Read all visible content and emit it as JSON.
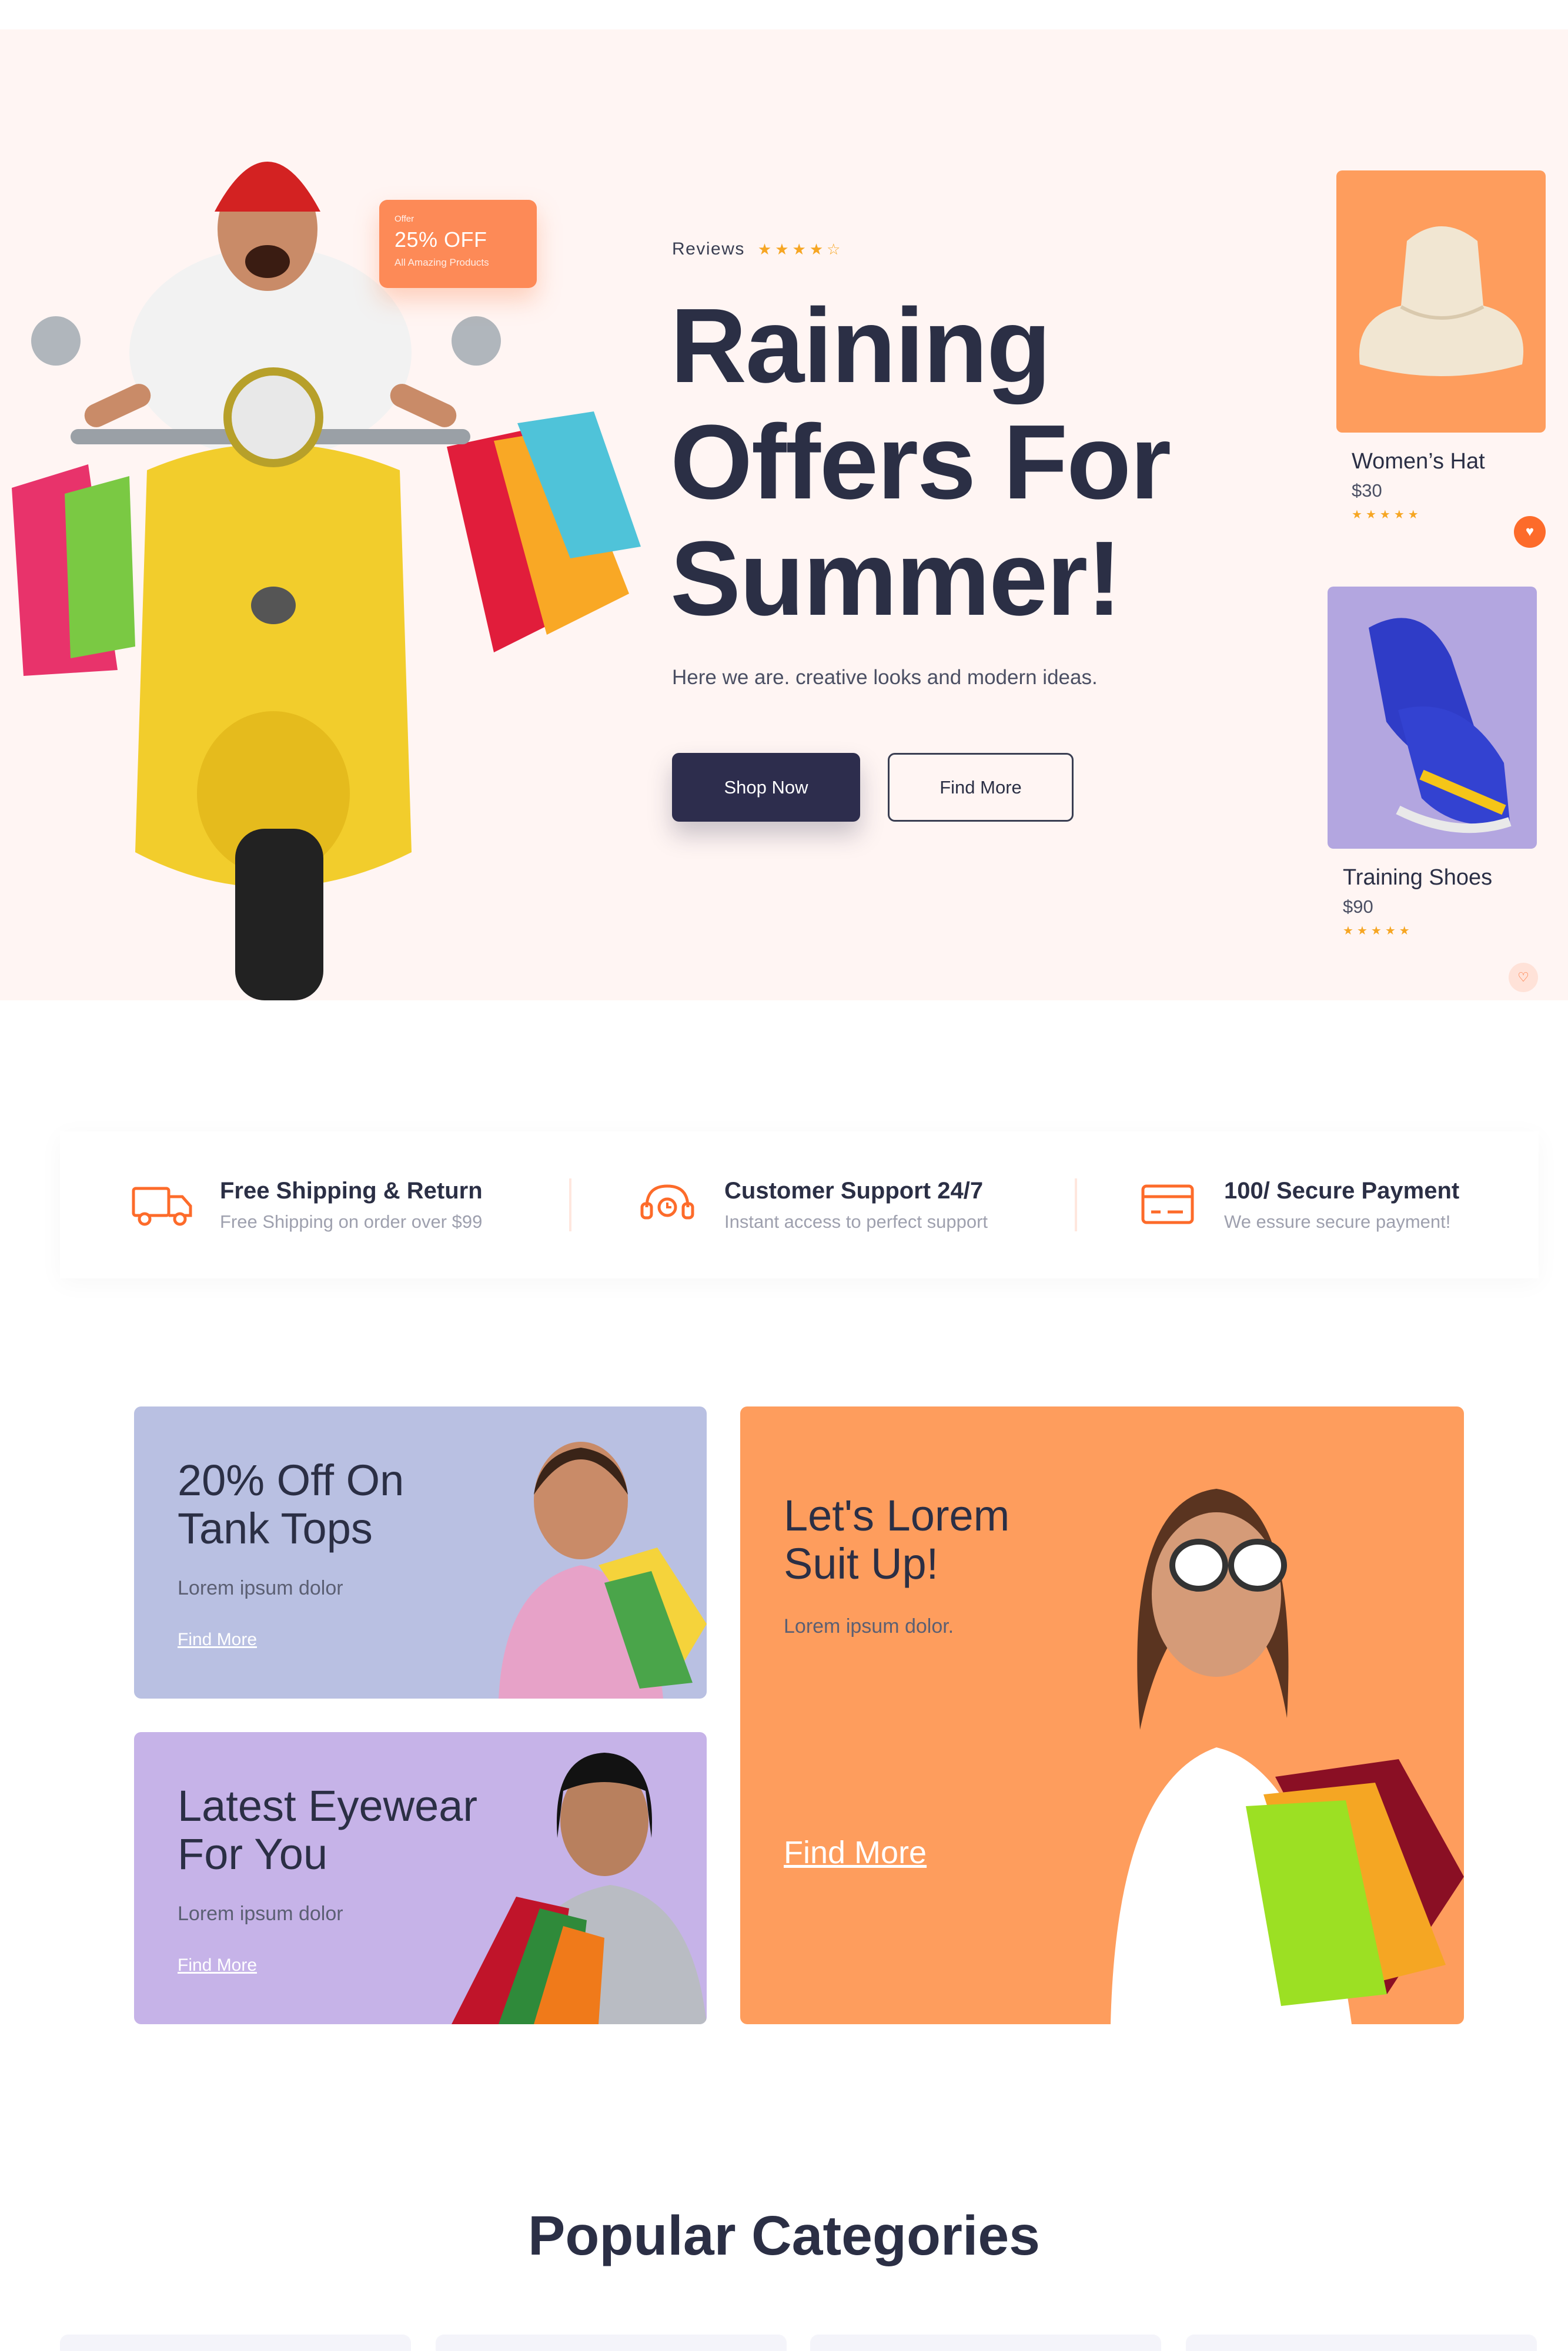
{
  "hero": {
    "offer": {
      "tag": "Offer",
      "discount": "25% OFF",
      "note": "All Amazing Products"
    },
    "reviews_label": "Reviews",
    "rating": 4,
    "headline_line1": "Raining",
    "headline_line2": "Offers For",
    "headline_line3": "Summer!",
    "subtitle": "Here we are. creative looks and modern ideas.",
    "shop_now": "Shop Now",
    "find_more": "Find More"
  },
  "products": [
    {
      "name": "Women’s Hat",
      "price": "$30",
      "rating": 5
    },
    {
      "name": "Training Shoes",
      "price": "$90",
      "rating": 5
    }
  ],
  "features": [
    {
      "title": "Free Shipping & Return",
      "desc": "Free Shipping on order over $99",
      "icon": "truck-icon"
    },
    {
      "title": "Customer Support 24/7",
      "desc": "Instant access to perfect support",
      "icon": "headset-icon"
    },
    {
      "title": "100/ Secure Payment",
      "desc": "We essure secure payment!",
      "icon": "card-icon"
    }
  ],
  "promos": {
    "tank": {
      "title1": "20% Off On",
      "title2": "Tank Tops",
      "desc": "Lorem ipsum dolor",
      "link": "Find More"
    },
    "eyewear": {
      "title1": "Latest Eyewear",
      "title2": "For You",
      "desc": "Lorem ipsum dolor",
      "link": "Find More"
    },
    "suit": {
      "title1": "Let's Lorem",
      "title2": "Suit Up!",
      "desc": "Lorem ipsum dolor.",
      "link": "Find More"
    }
  },
  "popular_title": "Popular Categories",
  "colors": {
    "accent": "#fd8a57",
    "dark": "#2d2d4d",
    "hero_bg": "#fff5f3",
    "lavender": "#b9c0e2",
    "lilac": "#c6b3e8",
    "orange": "#fe9d5d"
  }
}
